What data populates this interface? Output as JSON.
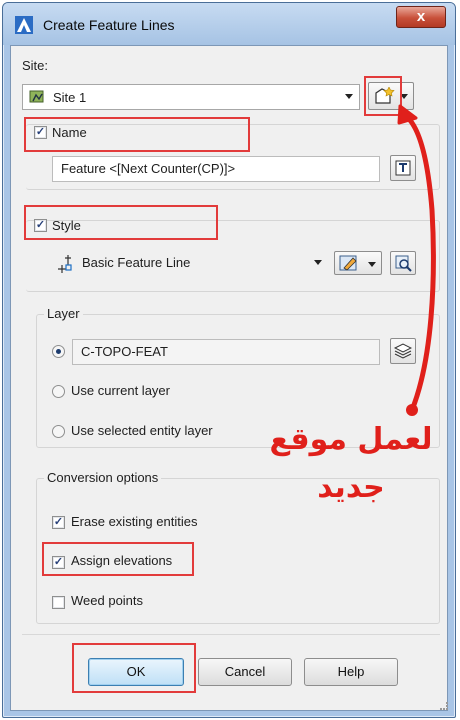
{
  "window": {
    "title": "Create Feature Lines",
    "close_label": "x"
  },
  "site": {
    "label": "Site:",
    "value": "Site 1",
    "new_site_icon": "new-site-icon"
  },
  "name": {
    "label": "Name",
    "checked": true,
    "value": "Feature <[Next Counter(CP)]>"
  },
  "style": {
    "label": "Style",
    "checked": true,
    "value": "Basic Feature Line"
  },
  "layer": {
    "group_label": "Layer",
    "options": [
      {
        "label": "C-TOPO-FEAT",
        "selected": true
      },
      {
        "label": "Use current layer",
        "selected": false
      },
      {
        "label": "Use selected entity layer",
        "selected": false
      }
    ]
  },
  "conversion": {
    "group_label": "Conversion options",
    "options": [
      {
        "label": "Erase existing entities",
        "checked": true
      },
      {
        "label": "Assign elevations",
        "checked": true
      },
      {
        "label": "Weed points",
        "checked": false
      }
    ]
  },
  "buttons": {
    "ok": "OK",
    "cancel": "Cancel",
    "help": "Help"
  },
  "annotation": {
    "line1": "لعمل موقع",
    "line2": "جديد",
    "color": "#e0201b"
  },
  "colors": {
    "highlight": "#e23b3b",
    "ok_border": "#3c7fb1"
  }
}
